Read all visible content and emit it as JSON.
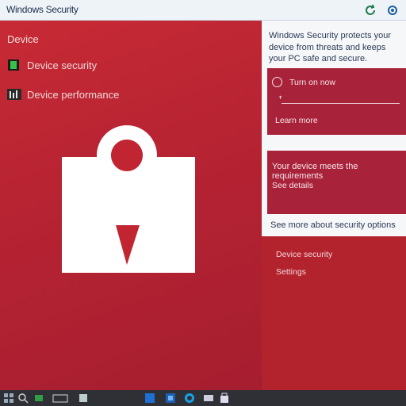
{
  "window": {
    "title": "Windows Security"
  },
  "sidebar": {
    "section_label": "Device",
    "items": [
      {
        "label": "Device security",
        "icon": "shield-check-icon"
      },
      {
        "label": "Device performance",
        "icon": "chart-icon"
      }
    ]
  },
  "hero": {
    "icon": "padlock-icon"
  },
  "right_panel": {
    "description": "Windows Security protects your device from threats and keeps your PC safe and secure.",
    "card1": {
      "row1": "Turn on now",
      "row2": "Learn more"
    },
    "card2": {
      "row1": "Your device meets the requirements",
      "row2": "See details"
    },
    "footer": "See more about security options"
  },
  "lower_links": [
    {
      "label": "Device security"
    },
    {
      "label": "Settings"
    }
  ],
  "colors": {
    "accent_red": "#b3232e",
    "card_red": "#a8223a",
    "panel_bg": "#f6f7f9",
    "taskbar": "#2e3036"
  }
}
